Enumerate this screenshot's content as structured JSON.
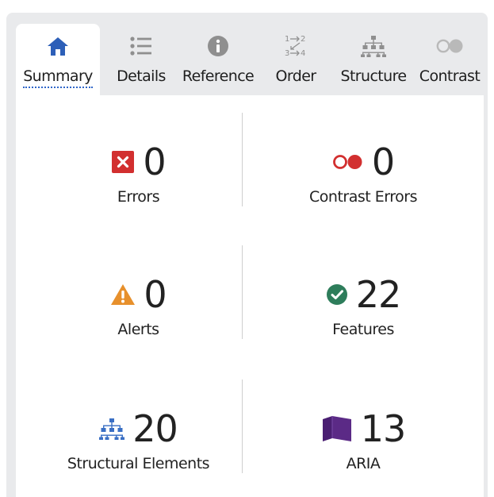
{
  "tabs": [
    {
      "label": "Summary",
      "icon": "home-icon",
      "active": true
    },
    {
      "label": "Details",
      "icon": "list-icon",
      "active": false
    },
    {
      "label": "Reference",
      "icon": "info-icon",
      "active": false
    },
    {
      "label": "Order",
      "icon": "order-icon",
      "active": false,
      "icon_text": [
        "1",
        "2",
        "3",
        "4"
      ]
    },
    {
      "label": "Structure",
      "icon": "structure-icon",
      "active": false
    },
    {
      "label": "Contrast",
      "icon": "contrast-icon",
      "active": false
    }
  ],
  "summary": {
    "errors": {
      "value": "0",
      "label": "Errors",
      "icon": "error-x-icon",
      "color": "#d22f2f"
    },
    "contrast_errors": {
      "value": "0",
      "label": "Contrast Errors",
      "icon": "contrast-error-icon",
      "color": "#d22f2f"
    },
    "alerts": {
      "value": "0",
      "label": "Alerts",
      "icon": "alert-triangle-icon",
      "color": "#e7902c"
    },
    "features": {
      "value": "22",
      "label": "Features",
      "icon": "check-circle-icon",
      "color": "#2e7d5b"
    },
    "structural": {
      "value": "20",
      "label": "Structural Elements",
      "icon": "structure-icon",
      "color": "#3a6fc4"
    },
    "aria": {
      "value": "13",
      "label": "ARIA",
      "icon": "aria-cube-icon",
      "color": "#5b2a86"
    }
  },
  "colors": {
    "accent": "#2f66c9",
    "tab_icon": "#8f8f8f",
    "tabbar_bg": "#e9eaec"
  }
}
